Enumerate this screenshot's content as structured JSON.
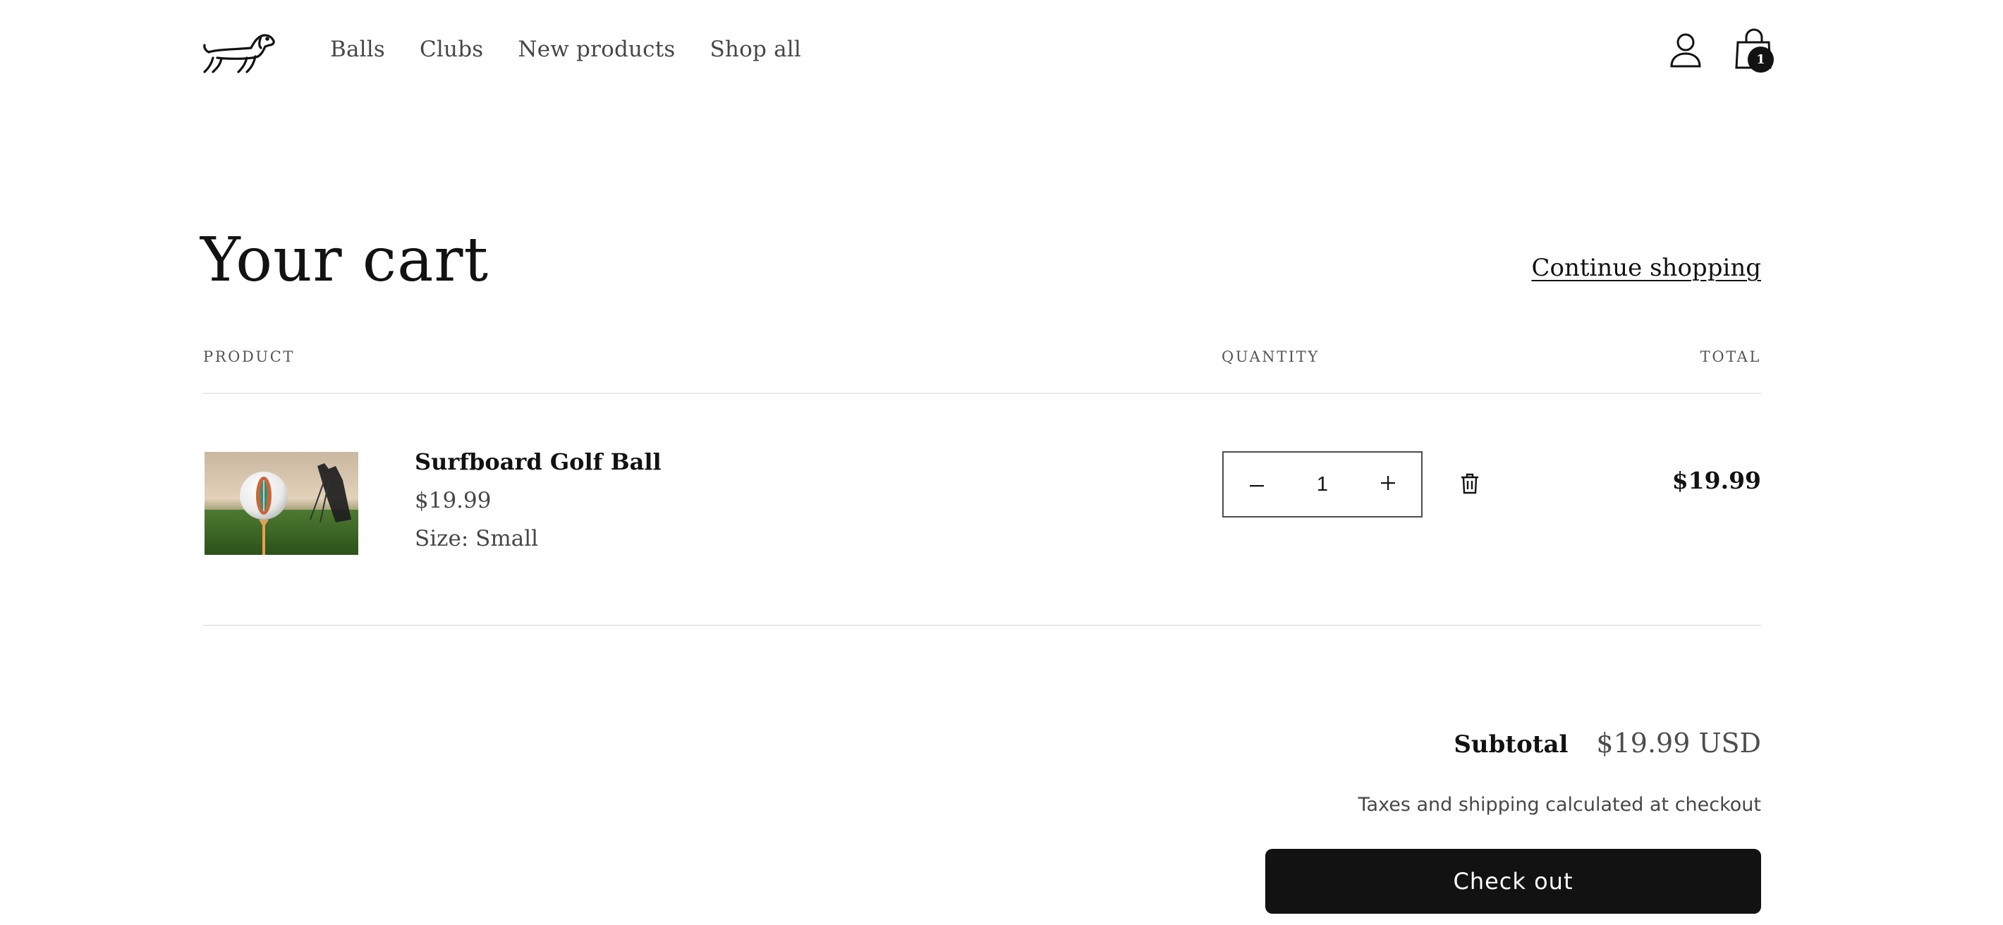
{
  "header": {
    "logo": {
      "icon": "dachshund-logo-icon"
    },
    "nav": [
      {
        "label": "Balls"
      },
      {
        "label": "Clubs"
      },
      {
        "label": "New products"
      },
      {
        "label": "Shop all"
      }
    ],
    "account": {
      "icon": "account-icon"
    },
    "cart": {
      "icon": "shopping-bag-icon",
      "count": "1"
    }
  },
  "cart": {
    "title": "Your cart",
    "continue_label": "Continue shopping",
    "columns": {
      "product": "PRODUCT",
      "quantity": "QUANTITY",
      "total": "TOTAL"
    },
    "items": [
      {
        "name": "Surfboard Golf Ball",
        "price": "$19.99",
        "option_label": "Size:",
        "option_value": "Small",
        "quantity": "1",
        "line_total": "$19.99",
        "image": "golf-ball-on-tee-image"
      }
    ]
  },
  "summary": {
    "subtotal_label": "Subtotal",
    "subtotal_value": "$19.99 USD",
    "tax_note": "Taxes and shipping calculated at checkout",
    "checkout_label": "Check out"
  },
  "colors": {
    "text": "#121212",
    "button_bg": "#121212",
    "button_text": "#ffffff",
    "background": "#ffffff"
  }
}
